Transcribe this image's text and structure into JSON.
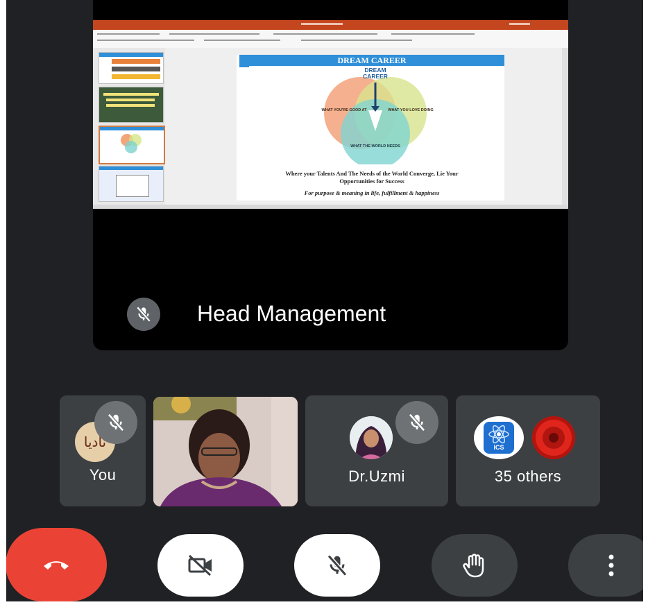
{
  "presenter": {
    "name": "Head Management",
    "slide": {
      "title": "DREAM CAREER",
      "venn_center_label": "DREAM CAREER",
      "circle_left": "WHAT YOU'RE GOOD AT",
      "circle_right": "WHAT YOU LOVE DOING",
      "circle_bottom": "WHAT THE WORLD NEEDS",
      "caption_line1": "Where your Talents And The Needs of the World Converge, Lie Your",
      "caption_line2": "Opportunities for Success",
      "caption_line3": "For purpose & meaning in life, fulfillment & happiness"
    }
  },
  "participants": [
    {
      "name": "You",
      "avatar_text": "نادیا",
      "muted": true
    },
    {
      "name": "",
      "has_video": true,
      "muted": false
    },
    {
      "name": "Dr.Uzmi",
      "muted": true
    },
    {
      "name": "35 others",
      "badge_text": "ICS"
    }
  ],
  "controls": {
    "end_call": "end-call",
    "camera": "camera-off",
    "mic": "mic-off",
    "hand": "raise-hand",
    "more": "more-options"
  },
  "colors": {
    "background": "#202124",
    "tile": "#3c4043",
    "end_call": "#ea4335",
    "control_light": "#ffffff",
    "control_dark": "#3c4043",
    "slide_header": "#2f8fd8"
  }
}
